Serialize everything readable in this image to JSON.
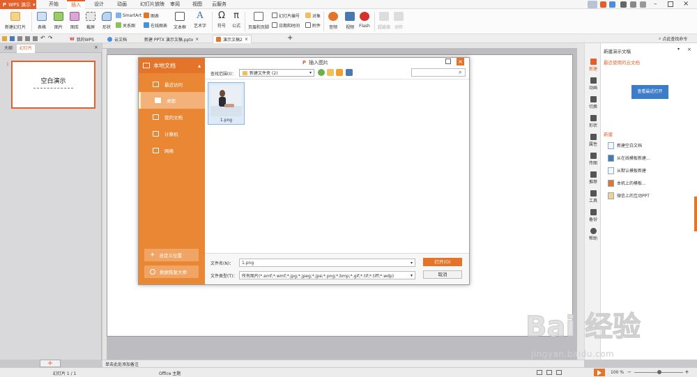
{
  "app": {
    "name": "WPS 演示"
  },
  "menu_tabs": [
    "开始",
    "插入",
    "设计",
    "动画",
    "幻灯片放映",
    "审阅",
    "视图",
    "云服务"
  ],
  "active_menu": "插入",
  "ribbon": {
    "new_slide": "新建幻灯片",
    "table": "表格",
    "picture": "图片",
    "gallery": "图库",
    "screenshot": "截屏",
    "shape": "形状",
    "smartart": "SmartArt",
    "chart": "图表",
    "relation": "关系图",
    "online_chart": "在线图表",
    "textbox": "文本框",
    "art": "艺术字",
    "symbol": "符号",
    "formula": "公式",
    "header_footer": "页眉和页脚",
    "slide_number": "幻灯片编号",
    "object": "对象",
    "date_time": "日期和时间",
    "attachment": "附件",
    "audio": "音频",
    "video": "视频",
    "flash": "Flash",
    "hyperlink": "超链接",
    "action": "动作"
  },
  "doc_tabs": [
    "我的WPS",
    "云文档",
    "新建 PPTX 演示文稿.pptx",
    "演示文稿2"
  ],
  "active_doc_tab": "演示文稿2",
  "find_command": "点此查找命令",
  "left_panel": {
    "tab_outline": "大纲",
    "tab_slides": "幻灯片",
    "slide_number": "1",
    "thumb_title": "空白演示"
  },
  "notes_placeholder": "单击此处添加备注",
  "status": {
    "slide_info": "幻灯片 1 / 1",
    "theme": "Office 主题",
    "zoom": "100 %"
  },
  "right_strip": [
    "新建",
    "动画",
    "切换",
    "形状",
    "属性",
    "传图",
    "推荐",
    "工具",
    "备份",
    "帮助"
  ],
  "right_panel": {
    "header": "新建演示文稿",
    "recent_title": "最近使用的云文档",
    "view_recent_btn": "查看最近打开",
    "new_title": "新建",
    "links": [
      "新建空白文档",
      "从在线模板新建...",
      "从默认模板新建",
      "本机上的模板...",
      "微信上的互动PPT"
    ]
  },
  "dialog": {
    "title": "插入图片",
    "side_header": "本地文档",
    "side_items": [
      "最近访问",
      "桌面",
      "我的文档",
      "计算机",
      "网络"
    ],
    "active_side": "桌面",
    "side_btn_custom": "自定义位置",
    "side_btn_recover": "数据恢复大师",
    "lookin_label": "查找范围(I)：",
    "lookin_value": "新建文件夹 (2)",
    "file_name": "1.png",
    "filename_label": "文件名(N)：",
    "filename_value": "1.png",
    "filetype_label": "文件类型(T)：",
    "filetype_value": "所有图片(*.emf;*.wmf;*.jpg;*.jpeg;*.jpe;*.png;*.bmp;*.gif;*.tif;*.tiff;*.wdp)",
    "open_btn": "打开(O)",
    "cancel_btn": "取消"
  },
  "watermark": {
    "brand": "Bai 经验",
    "url": "jingyan.baidu.com"
  },
  "colors": {
    "accent": "#e4602a",
    "sidebar": "#e98734"
  }
}
